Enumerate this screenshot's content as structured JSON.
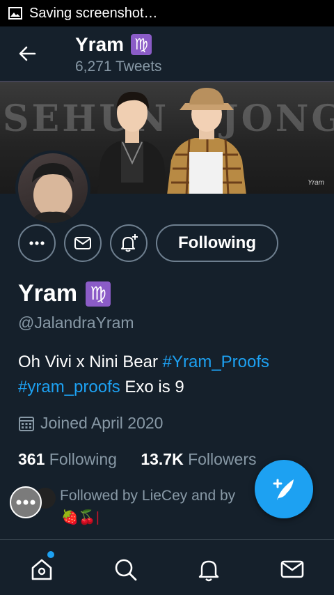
{
  "status_bar": {
    "text": "Saving screenshot…"
  },
  "header": {
    "name": "Yram",
    "zodiac_symbol": "♍",
    "tweet_count": "6,271 Tweets"
  },
  "banner": {
    "left_text": "SEHUN",
    "right_text": "JONGIN",
    "signature": "Yram"
  },
  "actions": {
    "following_label": "Following"
  },
  "profile": {
    "name": "Yram",
    "zodiac_symbol": "♍",
    "handle": "@JalandraYram",
    "bio_text_1": "Oh Vivi x Nini Bear ",
    "bio_hashtag_1": "#Yram_Proofs",
    "bio_hashtag_2": "#yram_proofs",
    "bio_text_2": " Exo is 9",
    "joined": "Joined April 2020",
    "following_count": "361",
    "following_label": "Following",
    "followers_count": "13.7K",
    "followers_label": "Followers",
    "followed_by": "Followed by LieCey and by",
    "followed_by_emoji": "🍓🍒|"
  },
  "icons": {
    "back": "arrow-left-icon",
    "more": "more-icon",
    "message": "envelope-icon",
    "notify": "bell-plus-icon",
    "calendar": "calendar-icon",
    "compose": "compose-feather-icon",
    "home": "home-icon",
    "search": "search-icon",
    "notifications": "bell-icon",
    "messages": "envelope-icon"
  },
  "colors": {
    "background": "#15202b",
    "accent": "#1da1f2",
    "muted": "#8899a6",
    "zodiac_badge": "#8b5cc7"
  }
}
